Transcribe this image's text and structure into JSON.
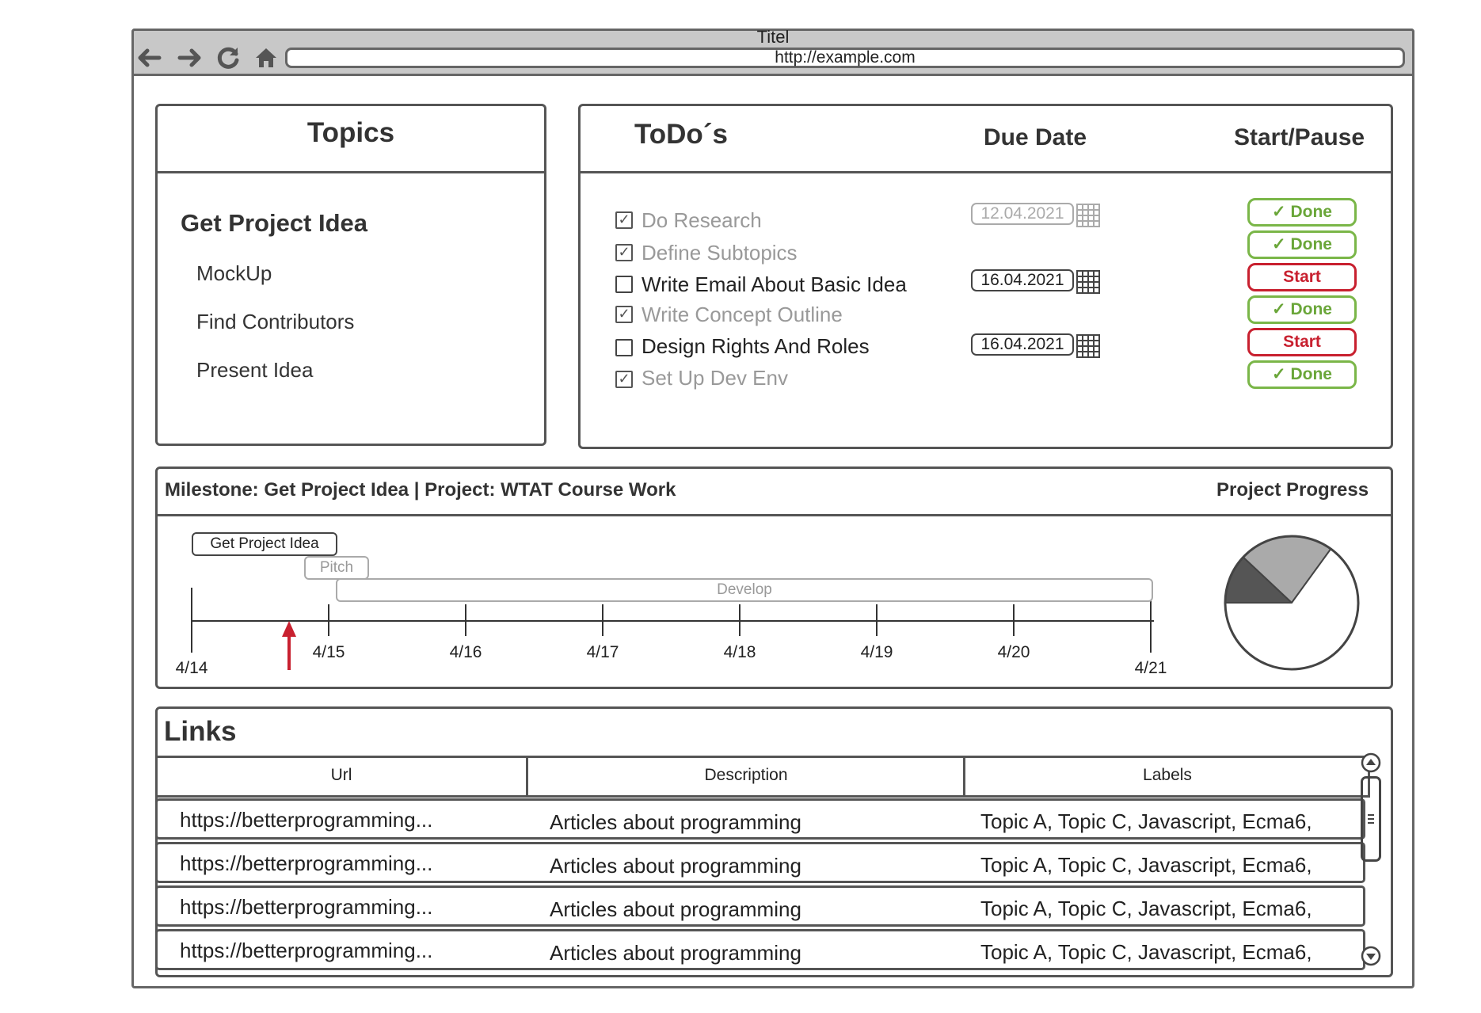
{
  "browser": {
    "title": "Titel",
    "url": "http://example.com",
    "nav_icons": [
      "back-arrow-icon",
      "forward-arrow-icon",
      "reload-icon",
      "home-icon"
    ]
  },
  "topics": {
    "header": "Topics",
    "milestone": "Get Project Idea",
    "items": [
      "MockUp",
      "Find Contributors",
      "Present Idea"
    ]
  },
  "todos": {
    "header_todo": "ToDo´s",
    "header_due": "Due Date",
    "header_action": "Start/Pause",
    "items": [
      {
        "label": "Do Research",
        "checked": true,
        "due": "12.04.2021",
        "action": "✓ Done"
      },
      {
        "label": "Define Subtopics",
        "checked": true,
        "due": "",
        "action": "✓ Done"
      },
      {
        "label": "Write Email About Basic Idea",
        "checked": false,
        "due": "16.04.2021",
        "action": "Start"
      },
      {
        "label": "Write Concept Outline",
        "checked": true,
        "due": "",
        "action": "✓ Done"
      },
      {
        "label": "Design Rights And Roles",
        "checked": false,
        "due": "16.04.2021",
        "action": "Start"
      },
      {
        "label": "Set Up Dev Env",
        "checked": true,
        "due": "",
        "action": "✓ Done"
      }
    ]
  },
  "milestone": {
    "header": "Milestone: Get Project Idea | Project: WTAT Course Work",
    "progress_label": "Project Progress",
    "phases": [
      "Get Project Idea",
      "Pitch",
      "Develop"
    ],
    "dates": [
      "4/14",
      "4/15",
      "4/16",
      "4/17",
      "4/18",
      "4/19",
      "4/20",
      "4/21"
    ]
  },
  "colors": {
    "done": "#7ab648",
    "start": "#c8202f",
    "marker": "#c8202f",
    "outline": "#555555"
  },
  "chart_data": {
    "type": "pie",
    "title": "Project Progress",
    "slices": [
      {
        "value": 0.12,
        "color": "#555555"
      },
      {
        "value": 0.23,
        "color": "#aaaaaa"
      },
      {
        "value": 0.65,
        "color": "#ffffff"
      }
    ]
  },
  "links": {
    "header": "Links",
    "columns": [
      "Url",
      "Description",
      "Labels"
    ],
    "rows": [
      [
        "https://betterprogramming...",
        "Articles about programming",
        "Topic A, Topic C, Javascript, Ecma6,"
      ],
      [
        "https://betterprogramming...",
        "Articles about programming",
        "Topic A, Topic C, Javascript, Ecma6,"
      ],
      [
        "https://betterprogramming...",
        "Articles about programming",
        "Topic A, Topic C, Javascript, Ecma6,"
      ],
      [
        "https://betterprogramming...",
        "Articles about programming",
        "Topic A, Topic C, Javascript, Ecma6,"
      ]
    ]
  }
}
